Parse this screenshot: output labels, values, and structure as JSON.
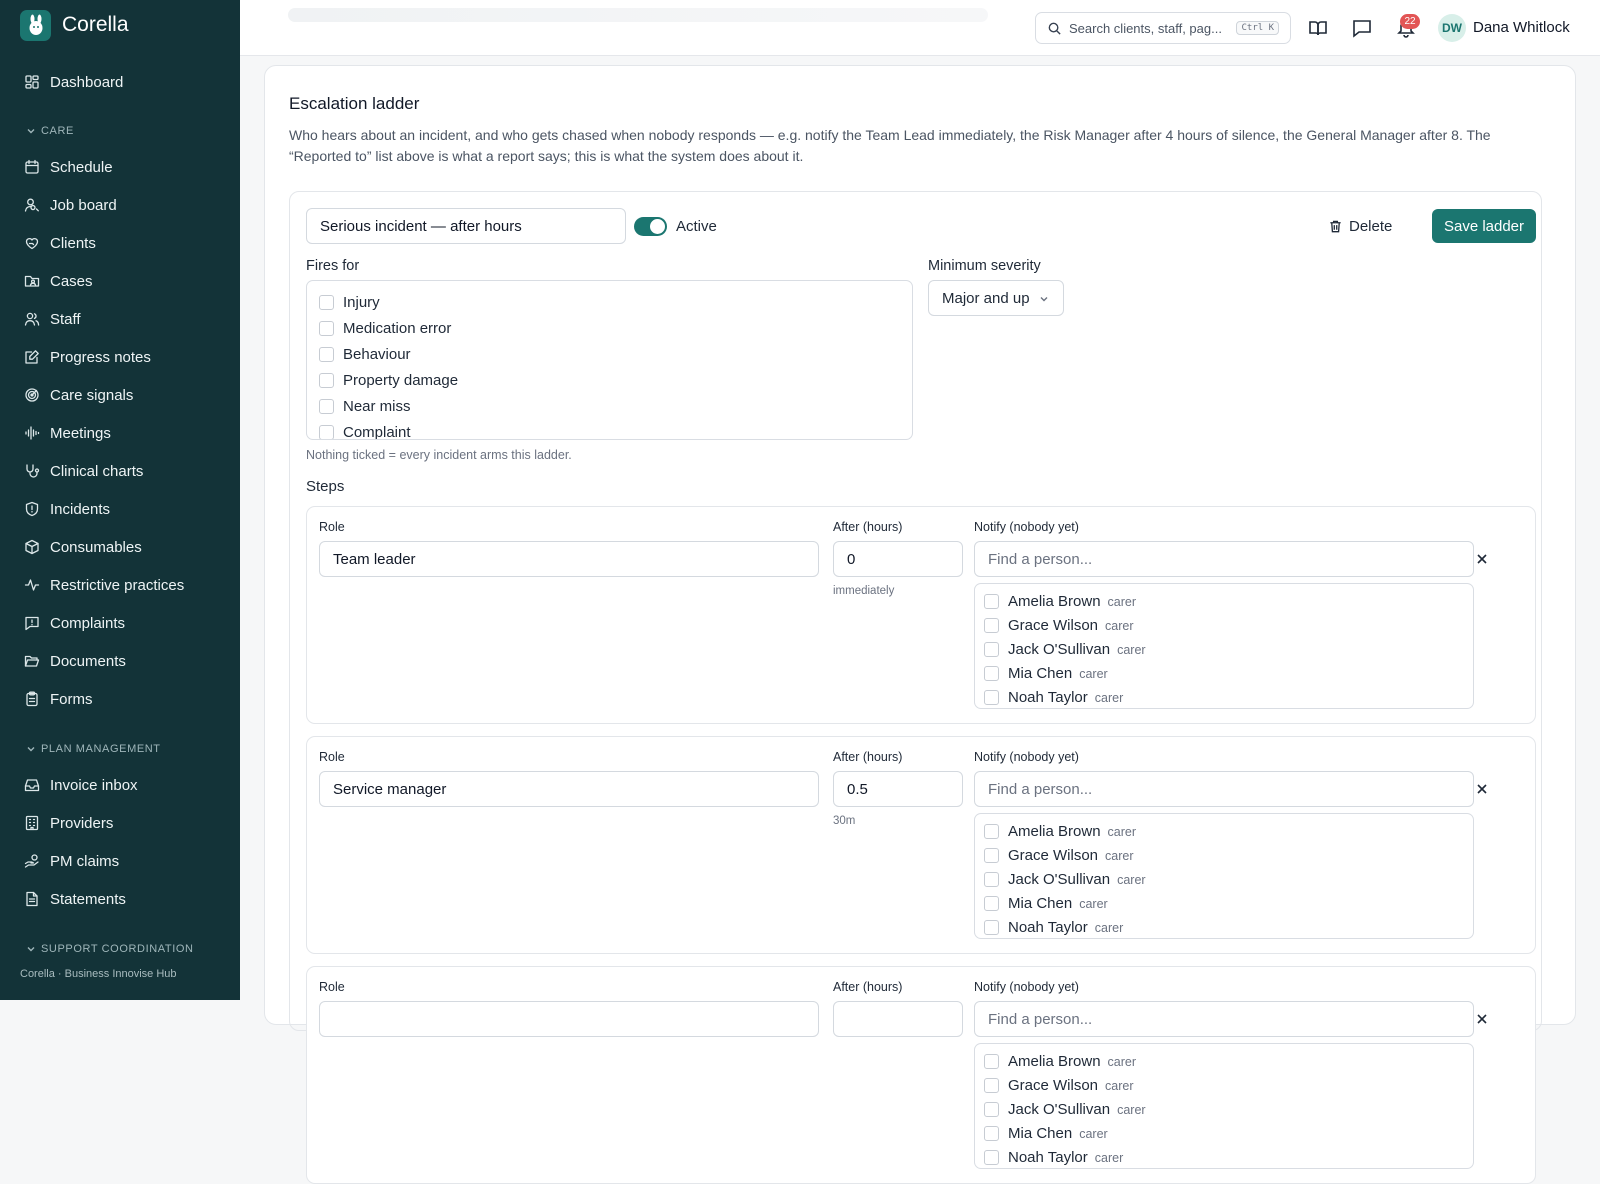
{
  "app": {
    "name": "Corella",
    "footer": "Corella · Business Innovise Hub"
  },
  "sidebar": {
    "dashboard": "Dashboard",
    "sections": {
      "care": "CARE",
      "plan": "PLAN MANAGEMENT",
      "support": "SUPPORT COORDINATION"
    },
    "care_items": [
      {
        "label": "Schedule",
        "icon": "calendar-icon"
      },
      {
        "label": "Job board",
        "icon": "user-search-icon"
      },
      {
        "label": "Clients",
        "icon": "heart-hand-icon"
      },
      {
        "label": "Cases",
        "icon": "folder-user-icon"
      },
      {
        "label": "Staff",
        "icon": "users-icon"
      },
      {
        "label": "Progress notes",
        "icon": "note-edit-icon"
      },
      {
        "label": "Care signals",
        "icon": "radar-icon"
      },
      {
        "label": "Meetings",
        "icon": "audio-wave-icon"
      },
      {
        "label": "Clinical charts",
        "icon": "stethoscope-icon"
      },
      {
        "label": "Incidents",
        "icon": "shield-alert-icon"
      },
      {
        "label": "Consumables",
        "icon": "package-icon"
      },
      {
        "label": "Restrictive practices",
        "icon": "activity-icon"
      },
      {
        "label": "Complaints",
        "icon": "message-alert-icon"
      },
      {
        "label": "Documents",
        "icon": "folder-open-icon"
      },
      {
        "label": "Forms",
        "icon": "clipboard-icon"
      }
    ],
    "plan_items": [
      {
        "label": "Invoice inbox",
        "icon": "inbox-icon"
      },
      {
        "label": "Providers",
        "icon": "building-icon"
      },
      {
        "label": "PM claims",
        "icon": "hand-coins-icon"
      },
      {
        "label": "Statements",
        "icon": "file-text-icon"
      }
    ]
  },
  "topbar": {
    "search_placeholder": "Search clients, staff, pag...",
    "shortcut": "Ctrl K",
    "notifications": "22",
    "user_initials": "DW",
    "user_name": "Dana Whitlock"
  },
  "card": {
    "title": "Escalation ladder",
    "description": "Who hears about an incident, and who gets chased when nobody responds — e.g. notify the Team Lead immediately, the Risk Manager after 4 hours of silence, the General Manager after 8. The “Reported to” list above is what a report says; this is what the system does about it."
  },
  "ladder": {
    "name": "Serious incident — after hours",
    "active_label": "Active",
    "delete_label": "Delete",
    "save_label": "Save ladder",
    "fires_for_label": "Fires for",
    "incident_types": [
      "Injury",
      "Medication error",
      "Behaviour",
      "Property damage",
      "Near miss",
      "Complaint"
    ],
    "min_severity_label": "Minimum severity",
    "min_severity_value": "Major and up",
    "help_text": "Nothing ticked = every incident arms this ladder.",
    "steps_label": "Steps",
    "col_role": "Role",
    "col_after": "After (hours)",
    "col_notify": "Notify (nobody yet)",
    "find_placeholder": "Find a person...",
    "people": [
      {
        "name": "Amelia Brown",
        "role": "carer"
      },
      {
        "name": "Grace Wilson",
        "role": "carer"
      },
      {
        "name": "Jack O'Sullivan",
        "role": "carer"
      },
      {
        "name": "Mia Chen",
        "role": "carer"
      },
      {
        "name": "Noah Taylor",
        "role": "carer"
      }
    ],
    "steps": [
      {
        "role": "Team leader",
        "after": "0",
        "hint": "immediately"
      },
      {
        "role": "Service manager",
        "after": "0.5",
        "hint": "30m"
      },
      {
        "role": "",
        "after": "",
        "hint": ""
      }
    ]
  }
}
